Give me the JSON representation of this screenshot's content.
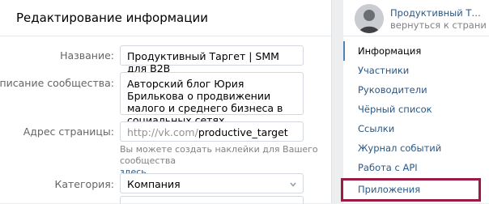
{
  "main": {
    "title": "Редактирование информации",
    "fields": {
      "name": {
        "label": "Название:",
        "value": "Продуктивный Таргет | SMM для B2B"
      },
      "description": {
        "label": "Описание сообщества:",
        "value": "Авторский блог  Юрия Брилькова о продвижении малого и среднего бизнеса в социальных сетях"
      },
      "address": {
        "label": "Адрес страницы:",
        "prefix": "http://vk.com/",
        "value": "productive_target"
      },
      "address_hint": "Вы можете создать наклейки для Вашего сообщества",
      "address_hint_link": "здесь.",
      "category": {
        "label": "Категория:",
        "value": "Компания"
      }
    }
  },
  "sidebar": {
    "community_name": "Продуктивный Таргет | S...",
    "back_link": "вернуться к странице",
    "items": [
      {
        "label": "Информация",
        "active": true
      },
      {
        "label": "Участники"
      },
      {
        "label": "Руководители"
      },
      {
        "label": "Чёрный список"
      },
      {
        "label": "Ссылки"
      },
      {
        "label": "Журнал событий"
      },
      {
        "label": "Работа с API"
      },
      {
        "label": "Приложения",
        "highlighted": true
      }
    ]
  },
  "icons": {
    "avatar": "user-photo",
    "select_arrow": "chevron-down-icon"
  },
  "colors": {
    "link": "#2a5885",
    "active_border": "#5181b8",
    "highlight": "#9b1b45"
  }
}
